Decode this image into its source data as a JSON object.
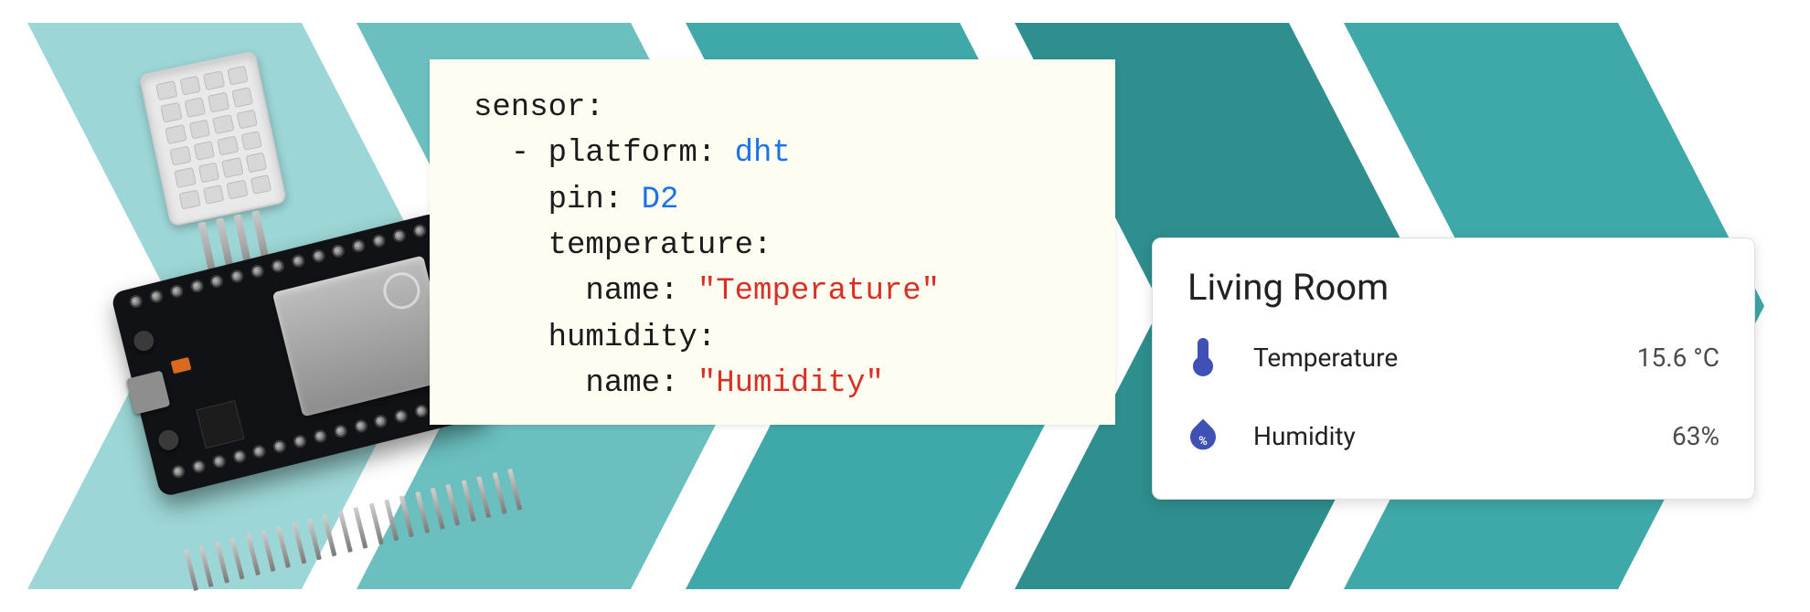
{
  "colors": {
    "chevron1": "#9dd6d6",
    "chevron2": "#6bbfbf",
    "chevron3": "#3fa8a8",
    "chevron4": "#2f8e8e",
    "chevron5": "#3fa8a8",
    "chevron_sep": "#1e5a4a",
    "code_keyword": "#1a73e8",
    "code_string": "#d93025",
    "ha_icon": "#3f51b5"
  },
  "yaml": {
    "l1": "sensor:",
    "l2a": "  - platform: ",
    "l2b": "dht",
    "l3a": "    pin: ",
    "l3b": "D2",
    "l4": "    temperature:",
    "l5a": "      name: ",
    "l5b": "\"Temperature\"",
    "l6": "    humidity:",
    "l7a": "      name: ",
    "l7b": "\"Humidity\""
  },
  "ha": {
    "title": "Living Room",
    "rows": [
      {
        "icon": "thermometer-icon",
        "label": "Temperature",
        "value": "15.6 °C"
      },
      {
        "icon": "water-percent-icon",
        "label": "Humidity",
        "value": "63%"
      }
    ]
  }
}
